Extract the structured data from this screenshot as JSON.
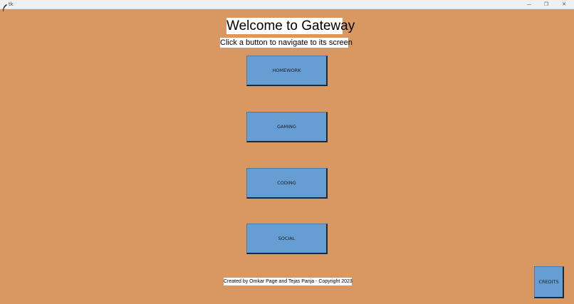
{
  "window": {
    "title": "tk",
    "minimize_glyph": "—",
    "maximize_glyph": "❐",
    "close_glyph": "✕"
  },
  "main": {
    "heading": "Welcome to Gateway",
    "subheading": "Click a button to navigate to its screen",
    "buttons": [
      {
        "label": "HOMEWORK"
      },
      {
        "label": "GAMING"
      },
      {
        "label": "CODING"
      },
      {
        "label": "SOCIAL"
      }
    ],
    "footer_text": "Created by Omkar Page and Tejas Panja - Copyright 2023",
    "credits_label": "CREDITS"
  },
  "colors": {
    "background": "#d99862",
    "button": "#669ed4",
    "label_bg": "#ffffff"
  },
  "icons": {
    "app": "feather-icon"
  }
}
